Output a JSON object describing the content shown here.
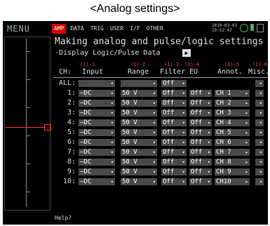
{
  "caption": "<Analog settings>",
  "header": {
    "menu": "MENU",
    "tabs": [
      "AMP",
      "DATA",
      "TRIG",
      "USER",
      "I/F",
      "OTHER"
    ],
    "date": "2010-03-03",
    "time": "19:52:47"
  },
  "panel": {
    "title": "Making analog and pulse/logic settings",
    "subtitle": "·Display Logic/Pulse Data",
    "arrow_button": "▶"
  },
  "annotations": [
    "(1)-1",
    "(1)-2",
    "(1)-3",
    "(1)-4",
    "(1)-5",
    "(1)-6"
  ],
  "columns": {
    "ch": "CH:",
    "input": "Input",
    "range": "Range",
    "filter": "Filter",
    "eu": "EU",
    "annot": "Annot.",
    "misc": "Misc."
  },
  "all_row": {
    "label": "ALL:",
    "filter": "Off"
  },
  "rows": [
    {
      "ch": "1:",
      "input": "—DC",
      "range": "50 V",
      "filter": "Off",
      "eu": "Off",
      "annot": "CH 1"
    },
    {
      "ch": "2:",
      "input": "—DC",
      "range": "50 V",
      "filter": "Off",
      "eu": "Off",
      "annot": "CH 2"
    },
    {
      "ch": "3:",
      "input": "—DC",
      "range": "50 V",
      "filter": "Off",
      "eu": "Off",
      "annot": "CH 3"
    },
    {
      "ch": "4:",
      "input": "—DC",
      "range": "50 V",
      "filter": "Off",
      "eu": "Off",
      "annot": "CH 4"
    },
    {
      "ch": "5:",
      "input": "—DC",
      "range": "50 V",
      "filter": "Off",
      "eu": "Off",
      "annot": "CH 5"
    },
    {
      "ch": "6:",
      "input": "—DC",
      "range": "50 V",
      "filter": "Off",
      "eu": "Off",
      "annot": "CH 6"
    },
    {
      "ch": "7:",
      "input": "—DC",
      "range": "50 V",
      "filter": "Off",
      "eu": "Off",
      "annot": "CH 7"
    },
    {
      "ch": "8:",
      "input": "—DC",
      "range": "50 V",
      "filter": "Off",
      "eu": "Off",
      "annot": "CH 8"
    },
    {
      "ch": "9:",
      "input": "—DC",
      "range": "50 V",
      "filter": "Off",
      "eu": "Off",
      "annot": "CH 9"
    },
    {
      "ch": "10:",
      "input": "—DC",
      "range": "50 V",
      "filter": "Off",
      "eu": "Off",
      "annot": "CH10"
    }
  ],
  "help": "Help?",
  "colors": {
    "active_tab": "#d50000",
    "annotation": "#ff4040",
    "dropdown": "#4a4a4a",
    "signal": "#ff3030"
  },
  "icons": {
    "dropdown": "triangle-down-icon",
    "annot_arrow": "triangle-right-icon"
  }
}
